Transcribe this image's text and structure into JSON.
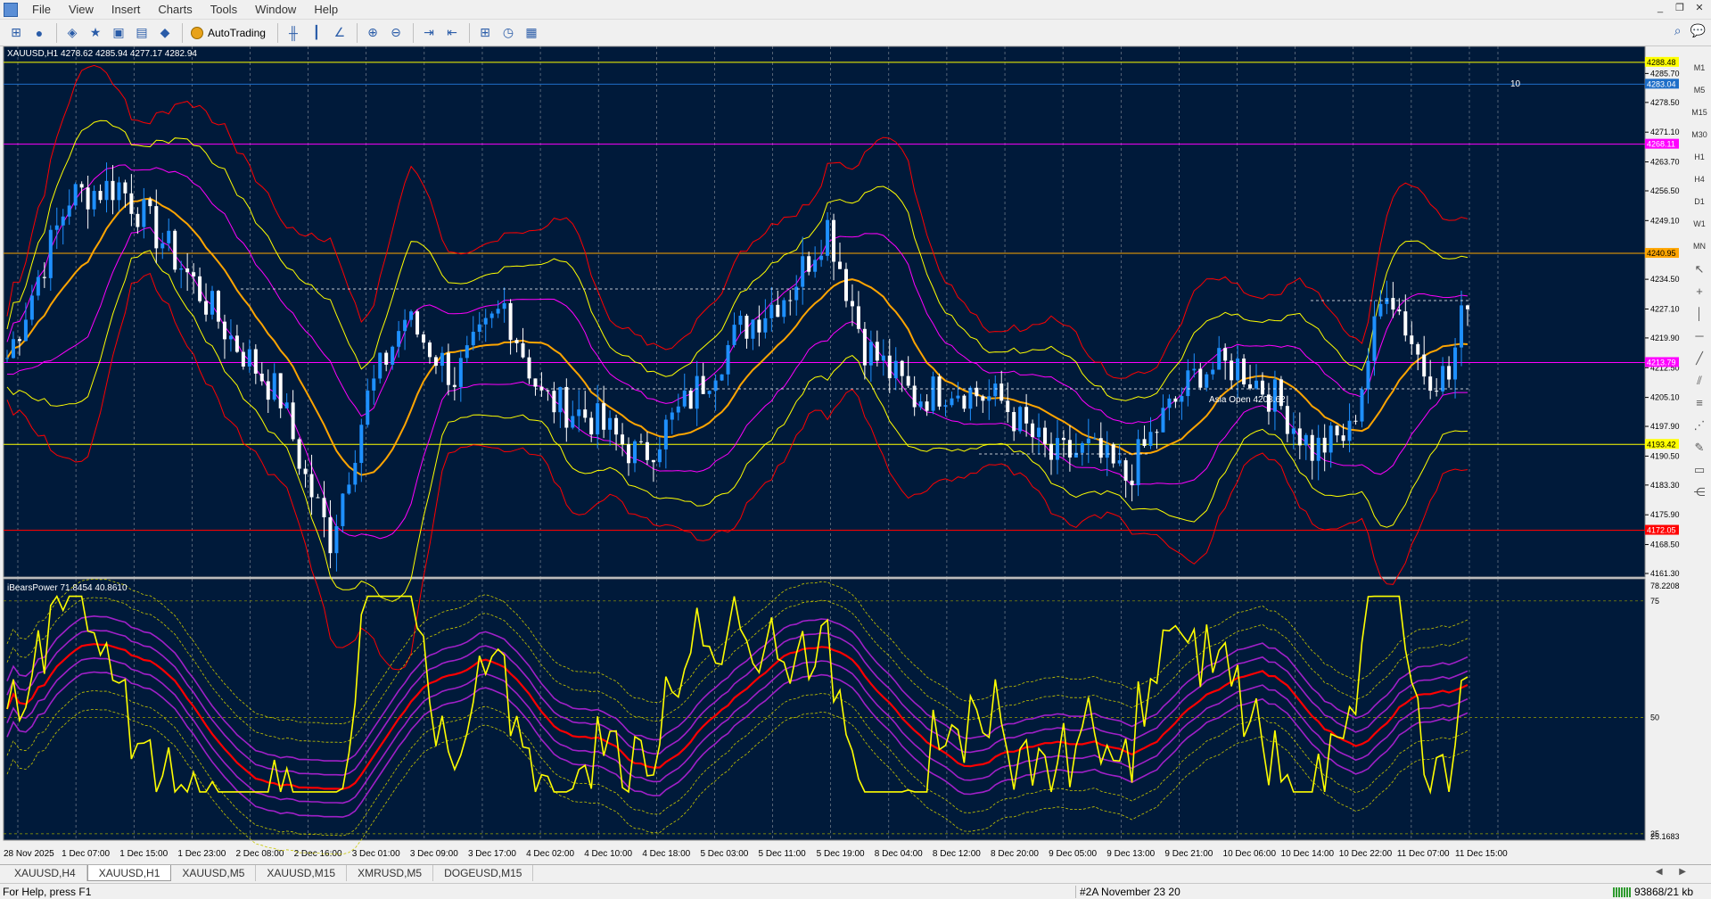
{
  "menu": {
    "items": [
      "File",
      "View",
      "Insert",
      "Charts",
      "Tools",
      "Window",
      "Help"
    ]
  },
  "toolbar": {
    "autotrading_label": "AutoTrading"
  },
  "chart": {
    "symbol_header": "XAUUSD,H1  4278.62 4285.94 4277.17 4282.94",
    "indicator_header": "iBearsPower  71.8454 40.8610",
    "price_ticks": [
      "4285.70",
      "4278.50",
      "4271.10",
      "4263.70",
      "4256.50",
      "4249.10",
      "4234.50",
      "4227.10",
      "4219.90",
      "4212.50",
      "4205.10",
      "4197.90",
      "4190.50",
      "4183.30",
      "4175.90",
      "4168.50",
      "4161.30"
    ],
    "price_tags": [
      {
        "text": "4288.48",
        "color": "#ffff00",
        "text_color": "#000000"
      },
      {
        "text": "4283.04",
        "color": "#1e6ec8",
        "text_color": "#ffffff"
      },
      {
        "text": "4268.11",
        "color": "#ff00ff",
        "text_color": "#ffffff"
      },
      {
        "text": "4240.95",
        "color": "#ffa500",
        "text_color": "#000000"
      },
      {
        "text": "4213.79",
        "color": "#ff00ff",
        "text_color": "#ffffff"
      },
      {
        "text": "4193.42",
        "color": "#ffff00",
        "text_color": "#000000"
      },
      {
        "text": "4172.05",
        "color": "#ff0000",
        "text_color": "#ffffff"
      }
    ],
    "indicator_ticks": [
      "78.2208",
      "75",
      "50",
      "25",
      "25.1683"
    ],
    "time_labels": [
      "28 Nov 2025",
      "1 Dec 07:00",
      "1 Dec 15:00",
      "1 Dec 23:00",
      "2 Dec 08:00",
      "2 Dec 16:00",
      "3 Dec 01:00",
      "3 Dec 09:00",
      "3 Dec 17:00",
      "4 Dec 02:00",
      "4 Dec 10:00",
      "4 Dec 18:00",
      "5 Dec 03:00",
      "5 Dec 11:00",
      "5 Dec 19:00",
      "8 Dec 04:00",
      "8 Dec 12:00",
      "8 Dec 20:00",
      "9 Dec 05:00",
      "9 Dec 13:00",
      "9 Dec 21:00",
      "10 Dec 06:00",
      "10 Dec 14:00",
      "10 Dec 22:00",
      "11 Dec 07:00",
      "11 Dec 15:00"
    ],
    "annotation_text": "Asia Open 4208.62",
    "spread_label": "10"
  },
  "timeframes": [
    "M1",
    "M5",
    "M15",
    "M30",
    "H1",
    "H4",
    "D1",
    "W1",
    "MN"
  ],
  "tabs": [
    "XAUUSD,H4",
    "XAUUSD,H1",
    "XAUUSD,M5",
    "XAUUSD,M15",
    "XMRUSD,M5",
    "DOGEUSD,M15"
  ],
  "active_tab": "XAUUSD,H1",
  "status": {
    "help": "For Help, press F1",
    "profile": "#2A November 23 20",
    "traffic": "93868/21 kb"
  },
  "colors": {
    "chart_bg": "#001a3a",
    "grid": "#c8c8c8",
    "up_candle": "#1e90ff",
    "down_candle": "#ffffff",
    "bb_outer": "#ff0000",
    "bb_mid": "#ffff00",
    "bb_inner": "#ff00ff",
    "ma": "#ffa500",
    "indicator_line": "#ffff00",
    "indicator_ma": "#ff0000"
  }
}
